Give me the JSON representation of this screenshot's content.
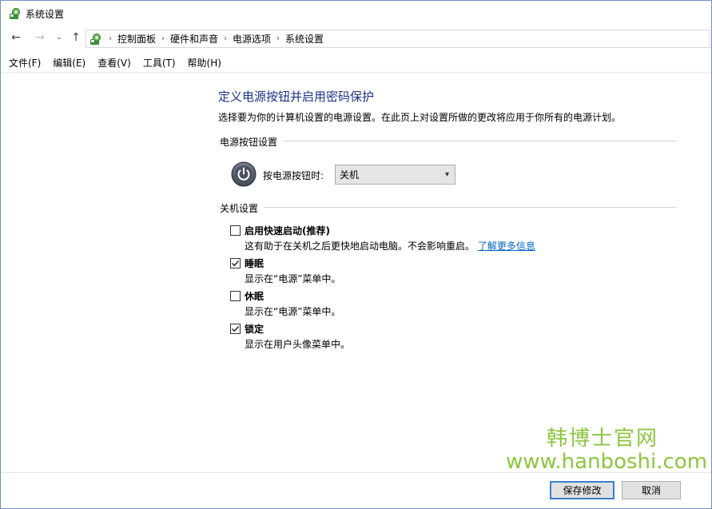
{
  "window": {
    "title": "系统设置"
  },
  "address": {
    "crumbs": [
      "控制面板",
      "硬件和声音",
      "电源选项",
      "系统设置"
    ]
  },
  "menu": {
    "items": [
      "文件(F)",
      "编辑(E)",
      "查看(V)",
      "工具(T)",
      "帮助(H)"
    ]
  },
  "page": {
    "title": "定义电源按钮并启用密码保护",
    "description": "选择要为你的计算机设置的电源设置。在此页上对设置所做的更改将应用于你所有的电源计划。"
  },
  "power_section": {
    "heading": "电源按钮设置",
    "label": "按电源按钮时:",
    "selected": "关机"
  },
  "shutdown_section": {
    "heading": "关机设置",
    "options": [
      {
        "label": "启用快速启动(推荐)",
        "desc": "这有助于在关机之后更快地启动电脑。不会影响重启。",
        "link": "了解更多信息",
        "checked": false
      },
      {
        "label": "睡眠",
        "desc": "显示在“电源”菜单中。",
        "checked": true
      },
      {
        "label": "休眠",
        "desc": "显示在“电源”菜单中。",
        "checked": false
      },
      {
        "label": "锁定",
        "desc": "显示在用户头像菜单中。",
        "checked": true
      }
    ]
  },
  "watermark": {
    "name": "韩博士官网",
    "url": "www.hanboshi.com"
  },
  "buttons": {
    "save": "保存修改",
    "cancel": "取消"
  },
  "colors": {
    "title": "#1e3287",
    "link": "#0066cc",
    "watermark": "#8cc63e",
    "accent": "#3c7fcb"
  }
}
